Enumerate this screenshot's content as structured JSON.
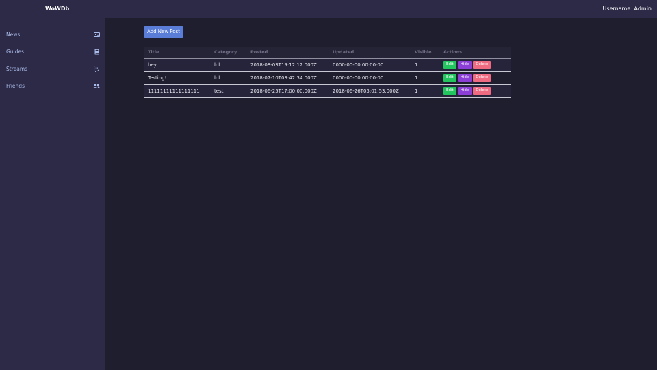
{
  "app": {
    "brand": "WoWDb",
    "user_label": "Username: Admin"
  },
  "sidebar": {
    "items": [
      {
        "label": "News",
        "icon": "newspaper-icon"
      },
      {
        "label": "Guides",
        "icon": "book-icon"
      },
      {
        "label": "Streams",
        "icon": "twitch-icon"
      },
      {
        "label": "Friends",
        "icon": "users-icon"
      }
    ]
  },
  "toolbar": {
    "add_label": "Add New Post"
  },
  "table": {
    "headers": [
      "Title",
      "Category",
      "Posted",
      "Updated",
      "Visible",
      "Actions"
    ],
    "actions": {
      "edit": "Edit",
      "hide": "Hide",
      "delete": "Delete"
    },
    "rows": [
      {
        "title": "hey",
        "category": "lol",
        "posted": "2018-08-03T19:12:12.000Z",
        "updated": "0000-00-00 00:00:00",
        "visible": "1"
      },
      {
        "title": "Testing!",
        "category": "lol",
        "posted": "2018-07-10T03:42:34.000Z",
        "updated": "0000-00-00 00:00:00",
        "visible": "1"
      },
      {
        "title": "11111111111111111",
        "category": "test",
        "posted": "2018-06-25T17:00:00.000Z",
        "updated": "2018-06-26T03:01:53.000Z",
        "visible": "1"
      }
    ]
  },
  "colors": {
    "topbar": "#2d2a47",
    "background": "#1e1e2e",
    "primary": "#5a7dd8",
    "edit": "#22c55e",
    "hide": "#8b3fd4",
    "delete": "#ef6b82",
    "sidebar_text": "#a9bbe8"
  }
}
